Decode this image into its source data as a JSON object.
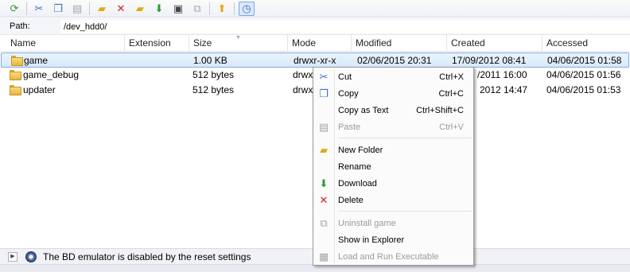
{
  "toolbar": {
    "icons": [
      "refresh-icon",
      "cut-icon",
      "copy-icon",
      "paste-icon",
      "open-folder-icon",
      "delete-icon",
      "new-folder-icon",
      "download-icon",
      "save-icon",
      "uninstall-icon",
      "upload-icon",
      "clock-icon"
    ]
  },
  "path": {
    "label": "Path:",
    "value": "/dev_hdd0/"
  },
  "columns": [
    "Name",
    "Extension",
    "Size",
    "Mode",
    "Modified",
    "Created",
    "Accessed"
  ],
  "rows": [
    {
      "name": "game",
      "extension": "",
      "size": "1.00 KB",
      "mode": "drwxr-xr-x",
      "modified": "02/06/2015 20:31",
      "created": "17/09/2012 08:41",
      "accessed": "04/06/2015 01:58"
    },
    {
      "name": "game_debug",
      "extension": "",
      "size": "512 bytes",
      "mode": "drwx",
      "modified": "",
      "created": "/2011 16:00",
      "accessed": "04/06/2015 01:56"
    },
    {
      "name": "updater",
      "extension": "",
      "size": "512 bytes",
      "mode": "drwx",
      "modified": "",
      "created": "2012 14:47",
      "accessed": "04/06/2015 01:53"
    }
  ],
  "context_menu": {
    "items": [
      {
        "label": "Cut",
        "shortcut": "Ctrl+X",
        "icon": "cut-icon",
        "enabled": true
      },
      {
        "label": "Copy",
        "shortcut": "Ctrl+C",
        "icon": "copy-icon",
        "enabled": true
      },
      {
        "label": "Copy as Text",
        "shortcut": "Ctrl+Shift+C",
        "icon": "",
        "enabled": true
      },
      {
        "label": "Paste",
        "shortcut": "Ctrl+V",
        "icon": "paste-icon",
        "enabled": false
      },
      {
        "label": "New Folder",
        "shortcut": "",
        "icon": "new-folder-icon",
        "enabled": true
      },
      {
        "label": "Rename",
        "shortcut": "",
        "icon": "",
        "enabled": true
      },
      {
        "label": "Download",
        "shortcut": "",
        "icon": "download-icon",
        "enabled": true
      },
      {
        "label": "Delete",
        "shortcut": "",
        "icon": "delete-icon",
        "enabled": true
      },
      {
        "label": "Uninstall game",
        "shortcut": "",
        "icon": "uninstall-icon",
        "enabled": false
      },
      {
        "label": "Show in Explorer",
        "shortcut": "",
        "icon": "",
        "enabled": true
      },
      {
        "label": "Load and Run Executable",
        "shortcut": "",
        "icon": "executable-icon",
        "enabled": false
      }
    ]
  },
  "status": {
    "text": "The BD emulator is disabled by the reset settings"
  }
}
